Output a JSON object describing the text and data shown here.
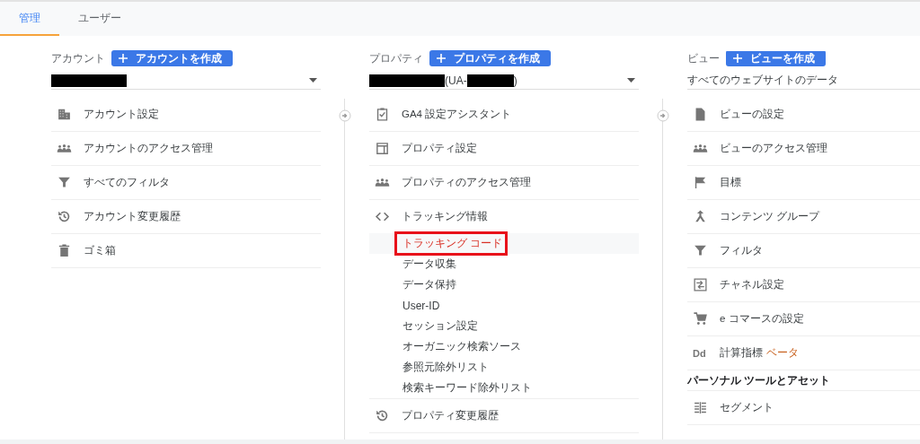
{
  "tabs": [
    {
      "label": "管理",
      "selected": true
    },
    {
      "label": "ユーザー",
      "selected": false
    }
  ],
  "columns": [
    {
      "label": "アカウント",
      "create_button": "アカウントを作成",
      "selector": {
        "dropdown": true,
        "segments": [
          {
            "kind": "redacted"
          }
        ]
      },
      "items": [
        {
          "kind": "item",
          "label": "アカウント設定"
        },
        {
          "kind": "item",
          "label": "アカウントのアクセス管理"
        },
        {
          "kind": "item",
          "label": "すべてのフィルタ"
        },
        {
          "kind": "item",
          "label": "アカウント変更履歴"
        },
        {
          "kind": "item",
          "label": "ゴミ箱"
        }
      ]
    },
    {
      "label": "プロパティ",
      "create_button": "プロパティを作成",
      "selector": {
        "dropdown": true,
        "segments": [
          {
            "kind": "redacted"
          },
          {
            "kind": "text",
            "text": "(UA-"
          },
          {
            "kind": "redacted"
          },
          {
            "kind": "text",
            "text": ")"
          }
        ]
      },
      "items": [
        {
          "kind": "item",
          "label": "GA4 設定アシスタント"
        },
        {
          "kind": "item",
          "label": "プロパティ設定"
        },
        {
          "kind": "item",
          "label": "プロパティのアクセス管理"
        },
        {
          "kind": "item",
          "label": "トラッキング情報",
          "children": [
            {
              "label": "トラッキング コード",
              "selected": true,
              "annotated": true
            },
            {
              "label": "データ収集",
              "selected": false,
              "annotated": false
            },
            {
              "label": "データ保持",
              "selected": false,
              "annotated": false
            },
            {
              "label": "User-ID",
              "selected": false,
              "annotated": false
            },
            {
              "label": "セッション設定",
              "selected": false,
              "annotated": false
            },
            {
              "label": "オーガニック検索ソース",
              "selected": false,
              "annotated": false
            },
            {
              "label": "参照元除外リスト",
              "selected": false,
              "annotated": false
            },
            {
              "label": "検索キーワード除外リスト",
              "selected": false,
              "annotated": false
            }
          ]
        },
        {
          "kind": "item",
          "label": "プロパティ変更履歴"
        }
      ]
    },
    {
      "label": "ビュー",
      "create_button": "ビューを作成",
      "selector": {
        "dropdown": false,
        "segments": [
          {
            "kind": "text",
            "text": "すべてのウェブサイトのデータ"
          }
        ]
      },
      "items": [
        {
          "kind": "item",
          "label": "ビューの設定"
        },
        {
          "kind": "item",
          "label": "ビューのアクセス管理"
        },
        {
          "kind": "item",
          "label": "目標"
        },
        {
          "kind": "item",
          "label": "コンテンツ グループ"
        },
        {
          "kind": "item",
          "label": "フィルタ"
        },
        {
          "kind": "item",
          "label": "チャネル設定"
        },
        {
          "kind": "item",
          "label": "e コマースの設定"
        },
        {
          "kind": "item",
          "icon_text": "Dd",
          "label": "計算指標",
          "badge": "ベータ"
        },
        {
          "kind": "heading",
          "label": "パーソナル ツールとアセット"
        },
        {
          "kind": "item",
          "label": "セグメント"
        }
      ]
    }
  ]
}
